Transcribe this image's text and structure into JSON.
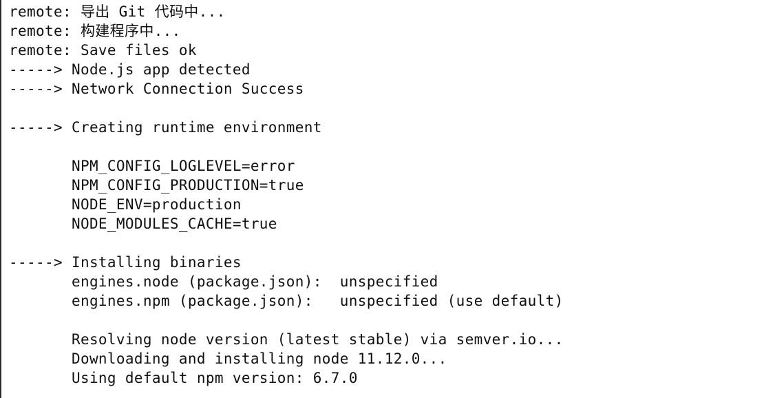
{
  "terminal": {
    "lines": [
      "remote: 导出 Git 代码中...",
      "remote: 构建程序中...",
      "remote: Save files ok",
      "-----> Node.js app detected",
      "-----> Network Connection Success",
      "",
      "-----> Creating runtime environment",
      "",
      "       NPM_CONFIG_LOGLEVEL=error",
      "       NPM_CONFIG_PRODUCTION=true",
      "       NODE_ENV=production",
      "       NODE_MODULES_CACHE=true",
      "",
      "-----> Installing binaries",
      "       engines.node (package.json):  unspecified",
      "       engines.npm (package.json):   unspecified (use default)",
      "",
      "       Resolving node version (latest stable) via semver.io...",
      "       Downloading and installing node 11.12.0...",
      "       Using default npm version: 6.7.0"
    ]
  }
}
